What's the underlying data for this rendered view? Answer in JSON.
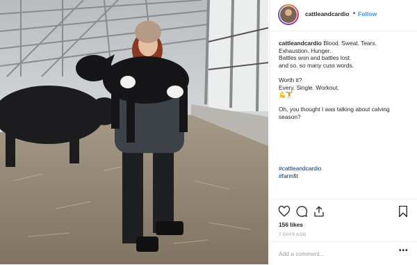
{
  "post": {
    "username": "cattleandcardio",
    "separator": "•",
    "follow_label": "Follow",
    "caption_lines": [
      "Blood. Sweat. Tears.",
      "Exhaustion. Hunger.",
      "Battles won and battles lost.",
      "and so. so many cuss words."
    ],
    "worth_line_1": "Worth it?",
    "worth_line_2": "Every. Single. Workout.",
    "emoji_line": "💪🏋",
    "question": "Oh, you thought I was talking about calving season?",
    "hashtags": [
      "#cattleandcardio",
      "#farmfit"
    ],
    "likes": "156 likes",
    "time_ago": "7 DAYS AGO",
    "comment_placeholder": "Add a comment...",
    "more_label": "•••"
  },
  "icons": {
    "like": "heart-icon",
    "comment": "comment-icon",
    "share": "share-icon",
    "save": "bookmark-icon",
    "more": "more-icon"
  },
  "colors": {
    "link": "#3897f0",
    "hashtag": "#003569",
    "text": "#262626",
    "muted": "#999999"
  }
}
